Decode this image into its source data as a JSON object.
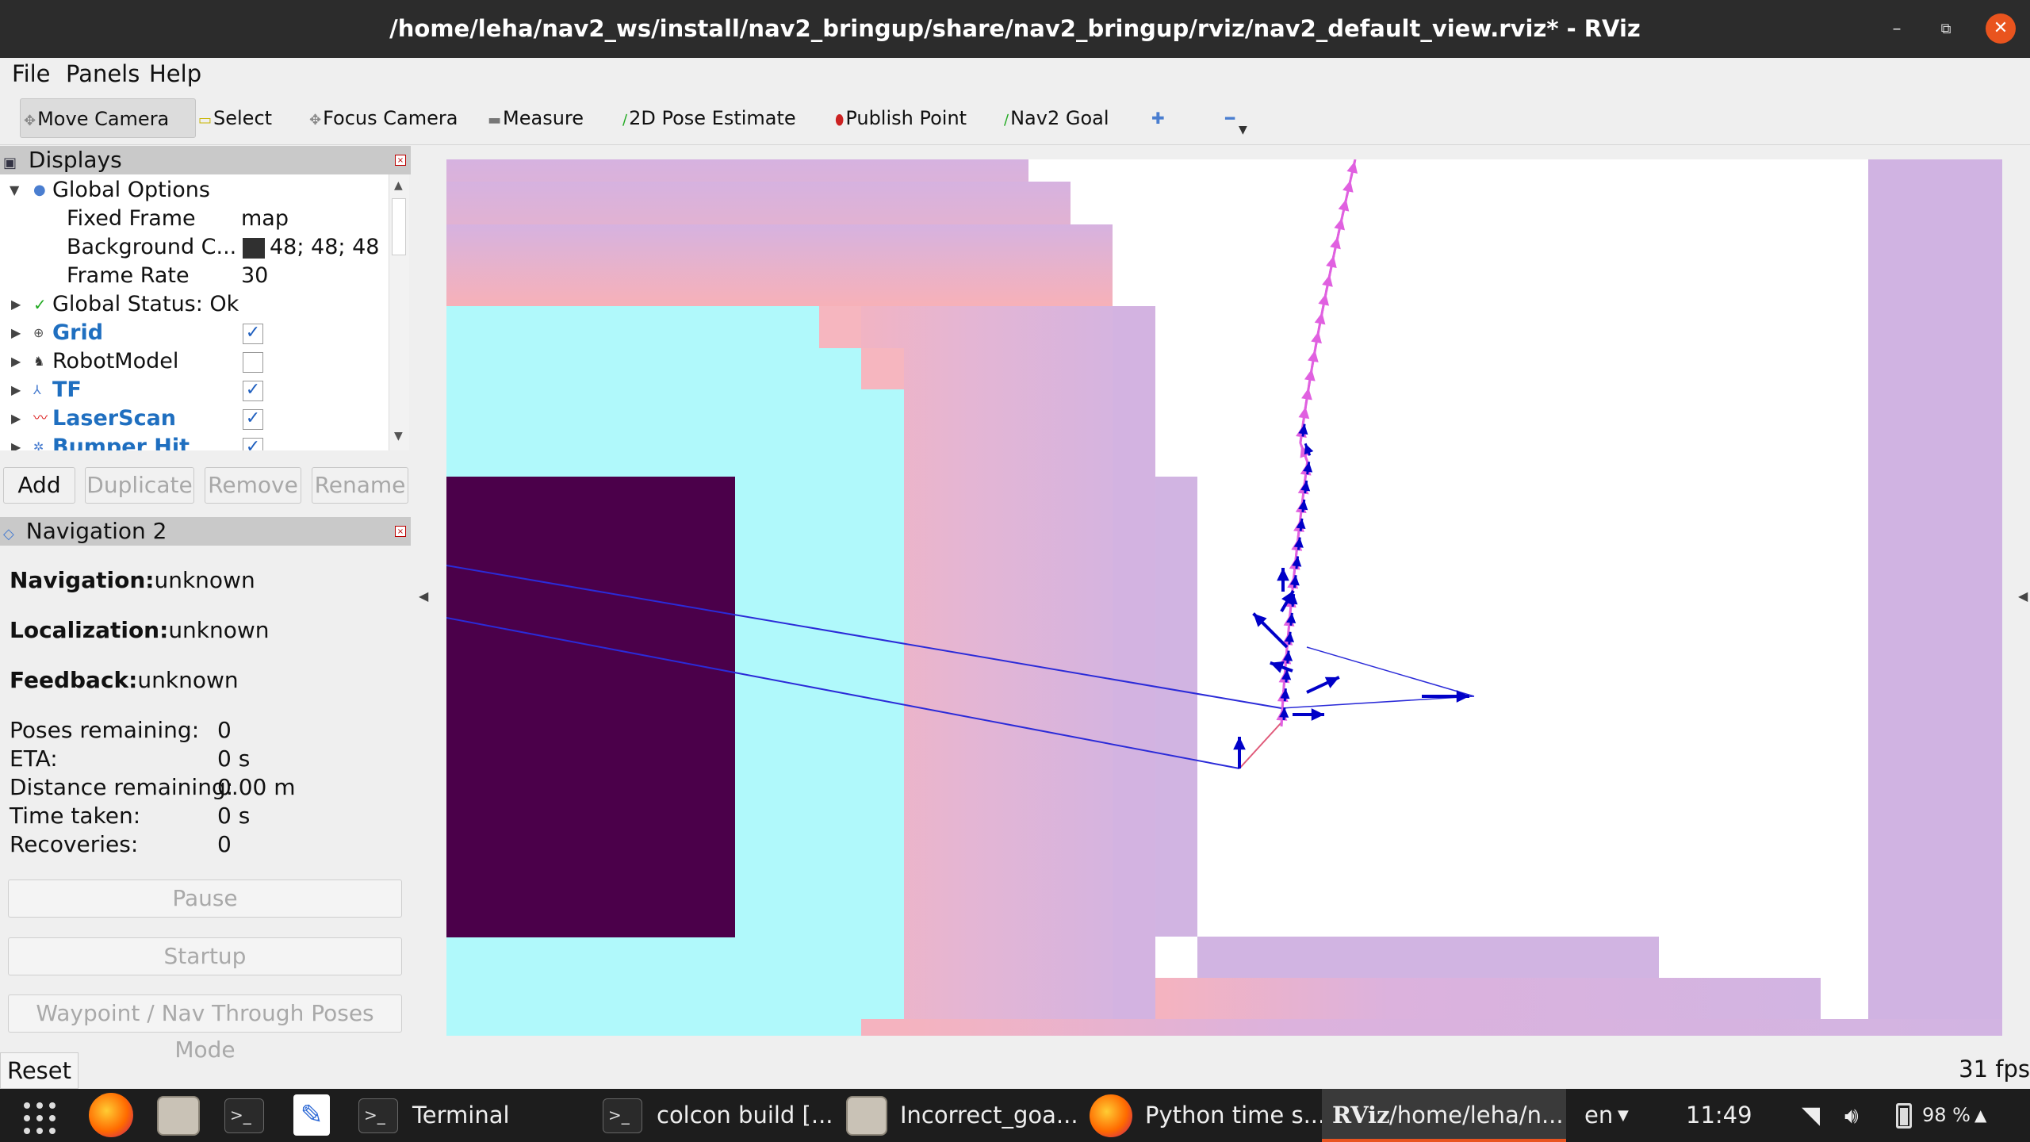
{
  "window": {
    "title": "/home/leha/nav2_ws/install/nav2_bringup/share/nav2_bringup/rviz/nav2_default_view.rviz* - RViz",
    "minimize_glyph": "–",
    "maximize_glyph": "⧉",
    "close_glyph": "✕"
  },
  "menu": {
    "items": [
      "File",
      "Panels",
      "Help"
    ]
  },
  "toolbar": {
    "move_camera": "Move Camera",
    "select": "Select",
    "focus_camera": "Focus Camera",
    "measure": "Measure",
    "pose_estimate": "2D Pose Estimate",
    "publish_point": "Publish Point",
    "nav2_goal": "Nav2 Goal"
  },
  "displays": {
    "title": "Displays",
    "global_options": "Global Options",
    "fixed_frame_label": "Fixed Frame",
    "fixed_frame_value": "map",
    "background_label": "Background C...",
    "background_value": "48; 48; 48",
    "background_color": "#303030",
    "frame_rate_label": "Frame Rate",
    "frame_rate_value": "30",
    "global_status": "Global Status: Ok",
    "items": [
      {
        "name": "Grid",
        "checked": "✓"
      },
      {
        "name": "RobotModel",
        "checked": ""
      },
      {
        "name": "TF",
        "checked": "✓"
      },
      {
        "name": "LaserScan",
        "checked": "✓"
      },
      {
        "name": "Bumper Hit",
        "checked": "✓"
      }
    ],
    "buttons": {
      "add": "Add",
      "duplicate": "Duplicate",
      "remove": "Remove",
      "rename": "Rename"
    }
  },
  "navigation": {
    "title": "Navigation 2",
    "navigation_label": "Navigation:",
    "navigation_value": "unknown",
    "localization_label": "Localization:",
    "localization_value": "unknown",
    "feedback_label": "Feedback:",
    "feedback_value": "unknown",
    "poses_remaining_label": "Poses remaining:",
    "poses_remaining_value": "0",
    "eta_label": "ETA:",
    "eta_value": "0 s",
    "distance_label": "Distance remaining:",
    "distance_value": "0.00 m",
    "time_taken_label": "Time taken:",
    "time_taken_value": "0 s",
    "recoveries_label": "Recoveries:",
    "recoveries_value": "0",
    "pause": "Pause",
    "startup": "Startup",
    "waypoint_mode": "Waypoint / Nav Through Poses Mode"
  },
  "statusbar": {
    "reset": "Reset",
    "fps": "31 fps"
  },
  "taskbar": {
    "terminal": "Terminal",
    "colcon": "colcon build [...",
    "incorrect": "Incorrect_goa...",
    "python": "Python time s...",
    "rviz_logo": "RViz",
    "rviz": "/home/leha/n...",
    "lang": "en",
    "clock": "11:49",
    "battery": "98 %"
  },
  "colors": {
    "costmap_purple": "#d0b3e2",
    "costmap_pink": "#f5b5be",
    "costmap_cyan": "#b0f9fb",
    "costmap_dark": "#4b004a",
    "path_magenta": "#e060e0",
    "pose_blue": "#0000c8"
  }
}
